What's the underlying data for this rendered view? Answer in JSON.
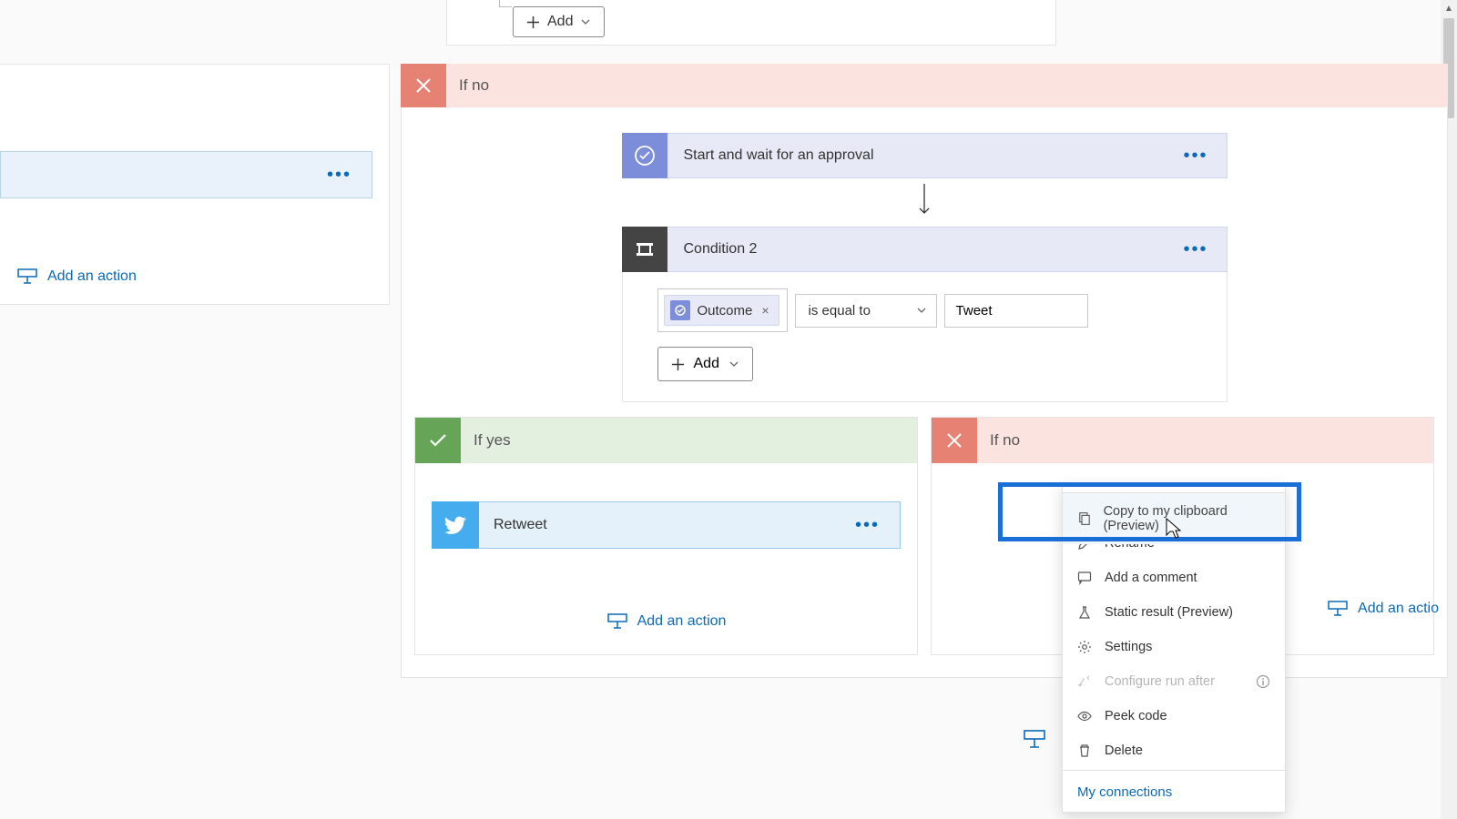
{
  "top": {
    "add_label": "Add"
  },
  "left": {
    "add_action": "Add an action"
  },
  "main_no": {
    "label": "If no"
  },
  "approval": {
    "title": "Start and wait for an approval"
  },
  "condition": {
    "title": "Condition 2",
    "token": "Outcome",
    "operator": "is equal to",
    "value": "Tweet",
    "add_label": "Add"
  },
  "nested": {
    "yes_label": "If yes",
    "no_label": "If no",
    "retweet_title": "Retweet",
    "add_action_yes": "Add an action",
    "add_action_no": "Add an actio"
  },
  "menu": {
    "copy": "Copy to my clipboard (Preview)",
    "rename": "Rename",
    "comment": "Add a comment",
    "static": "Static result (Preview)",
    "settings": "Settings",
    "configure": "Configure run after",
    "peek": "Peek code",
    "delete": "Delete",
    "connections": "My connections"
  }
}
